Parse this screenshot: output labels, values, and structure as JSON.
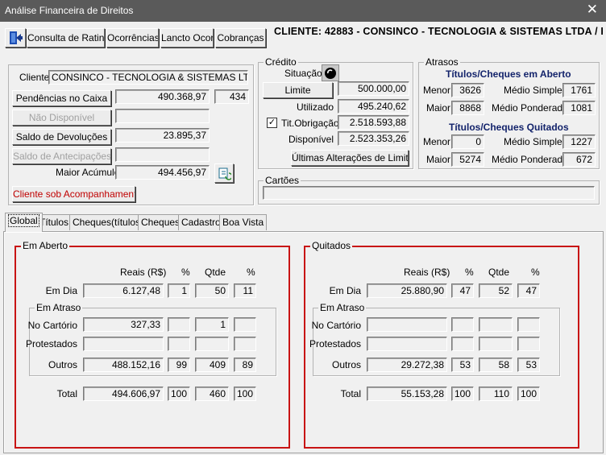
{
  "window": {
    "title": "Análise Financeira de Direitos",
    "close": "✕"
  },
  "toolbar": {
    "buttons": [
      "Consulta de Rating",
      "Ocorrências",
      "Lancto Ocor.",
      "Cobranças"
    ]
  },
  "header": {
    "cliente_banner": "CLIENTE: 42883 - CONSINCO - TECNOLOGIA & SISTEMAS LTDA  / I"
  },
  "cliente": {
    "label": "Cliente",
    "nome": "CONSINCO - TECNOLOGIA & SISTEMAS LTDA",
    "pendencias_btn": "Pendências no Caixa",
    "pendencias_valor": "490.368,97",
    "pendencias_qtd": "434",
    "nao_disponivel_btn": "Não Disponível",
    "devolucoes_btn": "Saldo de Devoluções",
    "devolucoes_valor": "23.895,37",
    "antecipacoes_btn": "Saldo de Antecipações",
    "maior_acumulo_label": "Maior Acúmulo",
    "maior_acumulo_valor": "494.456,97",
    "acompanhamento_btn": "Cliente sob Acompanhamento"
  },
  "credito": {
    "caption": "Crédito",
    "situacao_label": "Situação",
    "limite_btn": "Limite",
    "limite_valor": "500.000,00",
    "utilizado_label": "Utilizado",
    "utilizado_valor": "495.240,62",
    "titobrig_label": "Tit.Obrigação",
    "titobrig_valor": "2.518.593,88",
    "titobrig_checked": true,
    "disponivel_label": "Disponível",
    "disponivel_valor": "2.523.353,26",
    "alteracoes_btn": "Últimas Alterações de Limite"
  },
  "atrasos": {
    "caption": "Atrasos",
    "aberto_title": "Títulos/Cheques em Aberto",
    "quitados_title": "Títulos/Cheques Quitados",
    "menor_label": "Menor",
    "maior_label": "Maior",
    "medio_simples_label": "Médio Simples",
    "medio_ponderado_label": "Médio Ponderado",
    "aberto": {
      "menor": "3626",
      "maior": "8868",
      "medio_simples": "1761",
      "medio_ponderado": "1081"
    },
    "quitados": {
      "menor": "0",
      "maior": "5274",
      "medio_simples": "1227",
      "medio_ponderado": "672"
    }
  },
  "cartoes": {
    "caption": "Cartões"
  },
  "tabs": [
    "Global",
    "Títulos",
    "Cheques(títulos)",
    "Cheques",
    "Cadastro",
    "Boa Vista"
  ],
  "global": {
    "col_reais": "Reais (R$)",
    "col_pct": "%",
    "col_qtde": "Qtde",
    "em_dia_label": "Em Dia",
    "em_atraso_caption": "Em Atraso",
    "no_cartorio_label": "No Cartório",
    "protestados_label": "Protestados",
    "outros_label": "Outros",
    "total_label": "Total",
    "em_aberto": {
      "caption": "Em Aberto",
      "em_dia": {
        "reais": "6.127,48",
        "pct": "1",
        "qtde": "50",
        "pct_q": "11"
      },
      "no_cartorio": {
        "reais": "327,33",
        "pct": "",
        "qtde": "1",
        "pct_q": ""
      },
      "protestados": {
        "reais": "",
        "pct": "",
        "qtde": "",
        "pct_q": ""
      },
      "outros": {
        "reais": "488.152,16",
        "pct": "99",
        "qtde": "409",
        "pct_q": "89"
      },
      "total": {
        "reais": "494.606,97",
        "pct": "100",
        "qtde": "460",
        "pct_q": "100"
      }
    },
    "quitados": {
      "caption": "Quitados",
      "em_dia": {
        "reais": "25.880,90",
        "pct": "47",
        "qtde": "52",
        "pct_q": "47"
      },
      "no_cartorio": {
        "reais": "",
        "pct": "",
        "qtde": "",
        "pct_q": ""
      },
      "protestados": {
        "reais": "",
        "pct": "",
        "qtde": "",
        "pct_q": ""
      },
      "outros": {
        "reais": "29.272,38",
        "pct": "53",
        "qtde": "58",
        "pct_q": "53"
      },
      "total": {
        "reais": "55.153,28",
        "pct": "100",
        "qtde": "110",
        "pct_q": "100"
      }
    }
  }
}
